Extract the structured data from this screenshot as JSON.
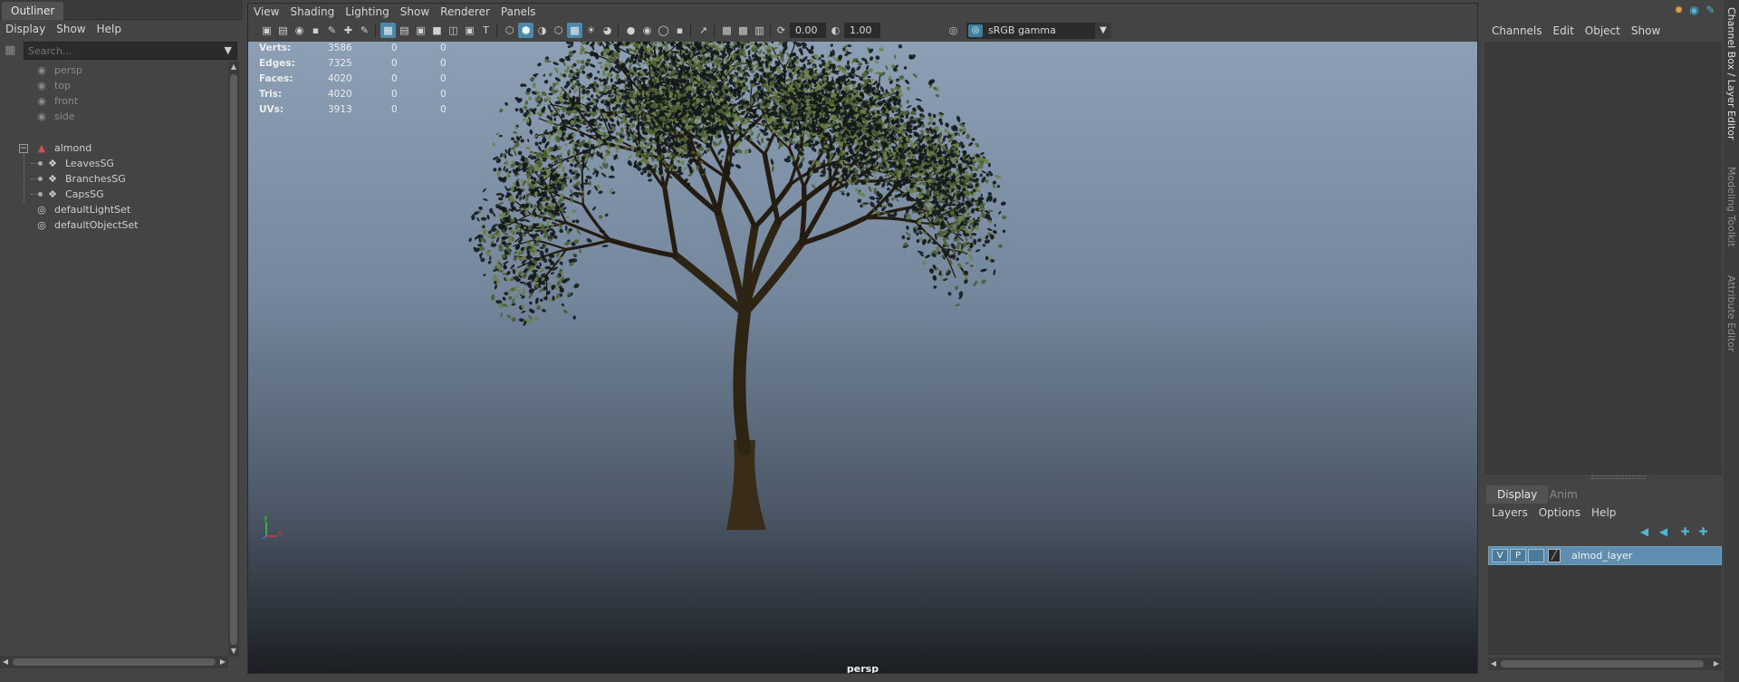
{
  "outliner": {
    "tab": "Outliner",
    "menu": [
      "Display",
      "Show",
      "Help"
    ],
    "search_placeholder": "Search...",
    "items": {
      "persp": "persp",
      "top": "top",
      "front": "front",
      "side": "side",
      "almond": "almond",
      "leaves": "LeavesSG",
      "branches": "BranchesSG",
      "caps": "CapsSG",
      "light_set": "defaultLightSet",
      "object_set": "defaultObjectSet"
    }
  },
  "viewport": {
    "menu": [
      "View",
      "Shading",
      "Lighting",
      "Show",
      "Renderer",
      "Panels"
    ],
    "exposure": "0.00",
    "gamma": "1.00",
    "color_space": "sRGB gamma",
    "camera": "persp",
    "hud": {
      "labels": [
        "Verts:",
        "Edges:",
        "Faces:",
        "Tris:",
        "UVs:"
      ],
      "values": [
        "3586",
        "7325",
        "4020",
        "4020",
        "3913"
      ],
      "col2": [
        "0",
        "0",
        "0",
        "0",
        "0"
      ],
      "col3": [
        "0",
        "0",
        "0",
        "0",
        "0"
      ]
    },
    "axis": {
      "y": "y",
      "x": "x"
    }
  },
  "channel_box": {
    "menu": [
      "Channels",
      "Edit",
      "Object",
      "Show"
    ]
  },
  "layer_editor": {
    "tabs": [
      "Display",
      "Anim"
    ],
    "menu": [
      "Layers",
      "Options",
      "Help"
    ],
    "layer": {
      "v": "V",
      "p": "P",
      "name": "almod_layer"
    }
  },
  "side_tabs": [
    "Channel Box / Layer Editor",
    "Modeling Toolkit",
    "Attribute Editor"
  ],
  "colors": {
    "accent": "#5f8eb0",
    "panel": "#444444",
    "field": "#2b2b2b"
  }
}
